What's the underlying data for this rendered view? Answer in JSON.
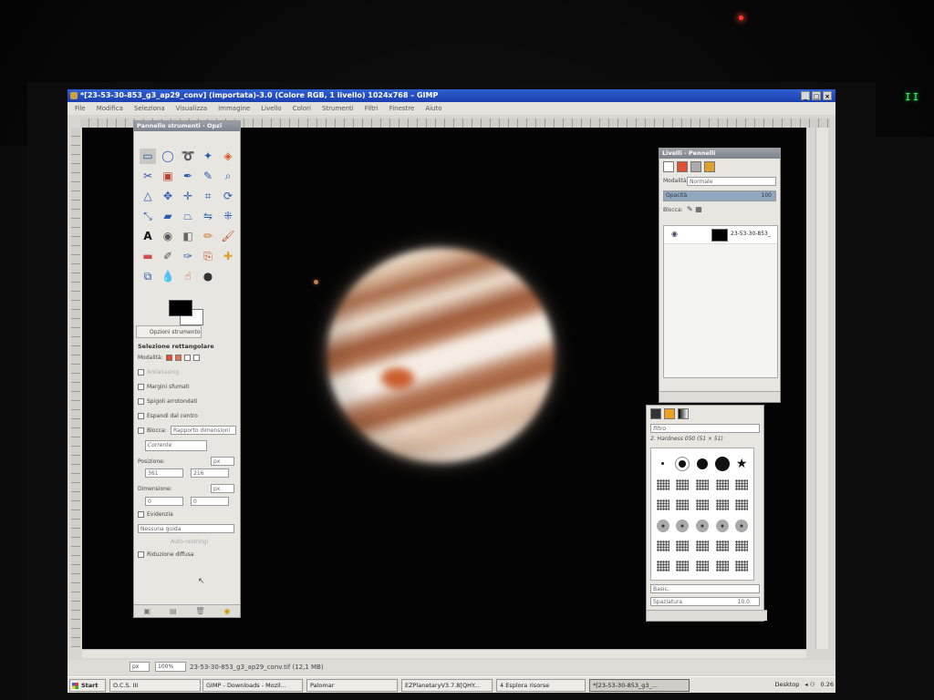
{
  "window": {
    "title": "*[23-53-30-853_g3_ap29_conv] (importata)-3.0 (Colore RGB, 1 livello) 1024x768 – GIMP"
  },
  "menu": [
    "File",
    "Modifica",
    "Seleziona",
    "Visualizza",
    "Immagine",
    "Livello",
    "Colori",
    "Strumenti",
    "Filtri",
    "Finestre",
    "Aiuto"
  ],
  "toolbox": {
    "title": "Pannello strumenti - Opzi",
    "options_tab": "Opzioni strumento",
    "tool_name": "Selezione rettangolare",
    "mode_label": "Modalità:",
    "antialias": "Antialiasing",
    "feather": "Margini sfumati",
    "rounded": "Spigoli arrotondati",
    "expand": "Espandi dal centro",
    "fixed": "Blocca:",
    "fixed_value": "Rapporto dimensioni",
    "current": "Corrente",
    "position_label": "Posizione:",
    "pos_x": "361",
    "pos_y": "216",
    "size_label": "Dimensione:",
    "size_w": "0",
    "size_h": "0",
    "unit": "px",
    "highlight": "Evidenzia",
    "guides": "Nessuna guida",
    "autoshrink": "Auto-restringi",
    "diffuse": "Riduzione diffusa"
  },
  "layers": {
    "title": "Livelli - Pennelli",
    "mode_label": "Modalità:",
    "mode_value": "Normale",
    "opacity_label": "Opacità",
    "opacity_value": "100",
    "lock_label": "Blocca:",
    "layer_name": "23-53-30-853_"
  },
  "brushes": {
    "filter": "filtro",
    "brush_name": "2. Hardness 050 (51 × 51)",
    "preset": "Basic,",
    "spacing_label": "Spaziatura",
    "spacing_value": "10.0"
  },
  "status": {
    "unit": "px",
    "zoom": "100%",
    "file": "23-53-30-853_g3_ap29_conv.tif (12,1 MB)"
  },
  "taskbar": {
    "start": "Start",
    "tasks": [
      "O.C.S. III",
      "GIMP - Downloads - Mozil...",
      "Palomar",
      "EZPlanetaryV3.7.8[QHY...",
      "4 Esplora risorse",
      "*[23-53-30-853_g3_..."
    ],
    "desktop": "Desktop",
    "clock": "0.26"
  }
}
